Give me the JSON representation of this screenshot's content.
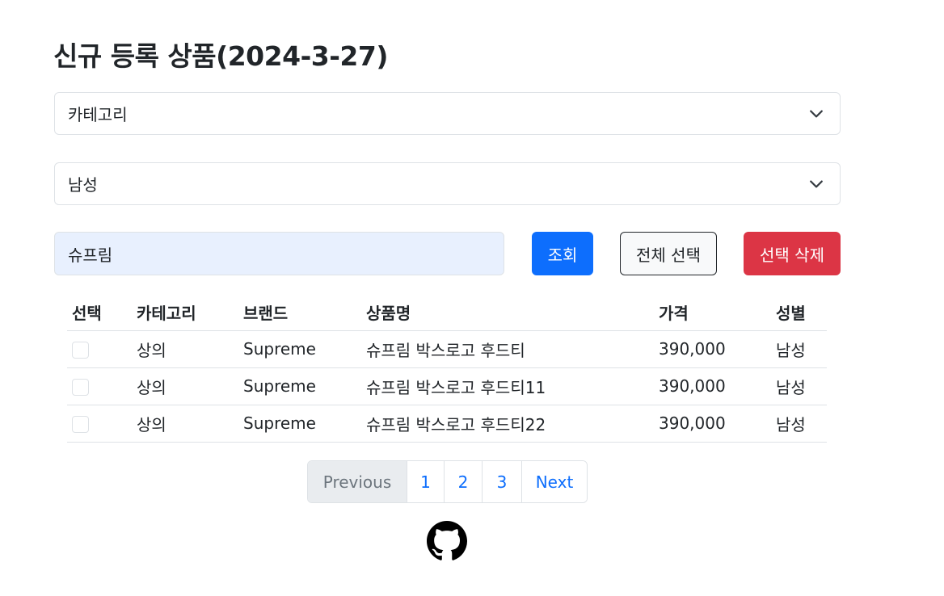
{
  "page": {
    "title": "신규 등록 상품(2024-3-27)"
  },
  "filters": {
    "category_select": {
      "selected": "카테고리"
    },
    "gender_select": {
      "selected": "남성"
    }
  },
  "search": {
    "value": "슈프림",
    "search_button": "조회",
    "select_all_button": "전체 선택",
    "delete_button": "선택 삭제"
  },
  "table": {
    "headers": {
      "select": "선택",
      "category": "카테고리",
      "brand": "브랜드",
      "name": "상품명",
      "price": "가격",
      "gender": "성별"
    },
    "rows": [
      {
        "checked": false,
        "category": "상의",
        "brand": "Supreme",
        "name": "슈프림 박스로고 후드티",
        "price": "390,000",
        "gender": "남성"
      },
      {
        "checked": false,
        "category": "상의",
        "brand": "Supreme",
        "name": "슈프림 박스로고 후드티11",
        "price": "390,000",
        "gender": "남성"
      },
      {
        "checked": false,
        "category": "상의",
        "brand": "Supreme",
        "name": "슈프림 박스로고 후드티22",
        "price": "390,000",
        "gender": "남성"
      }
    ]
  },
  "pagination": {
    "previous": "Previous",
    "pages": [
      "1",
      "2",
      "3"
    ],
    "next": "Next",
    "previous_disabled": true
  },
  "footer": {
    "icon": "github-icon"
  },
  "colors": {
    "primary": "#0d6efd",
    "danger": "#dc3545",
    "input_autofill": "#e8f0fe",
    "border": "#dee2e6"
  }
}
